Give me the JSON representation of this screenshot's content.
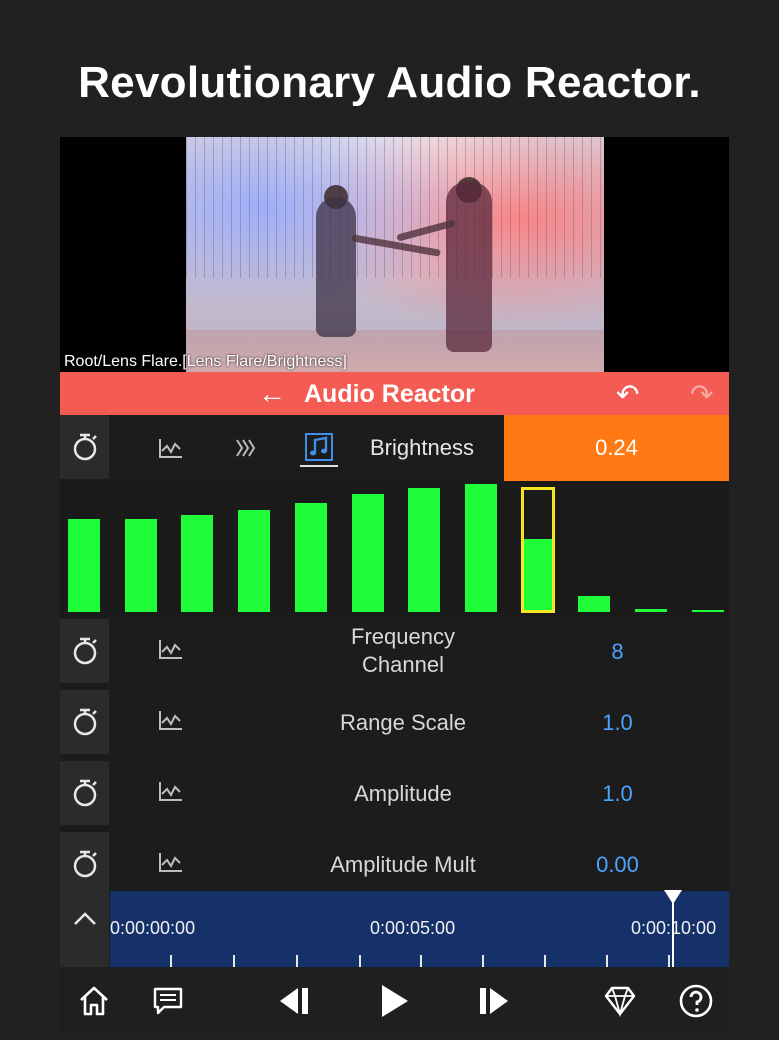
{
  "headline": "Revolutionary Audio Reactor.",
  "preview": {
    "path_label": "Root/Lens Flare.[Lens Flare/Brightness]"
  },
  "header": {
    "title": "Audio Reactor",
    "back_glyph": "←",
    "undo_glyph": "↶",
    "redo_glyph": "↷"
  },
  "selector": {
    "label": "Brightness",
    "value": "0.24"
  },
  "spectrum": {
    "bars": [
      0.74,
      0.74,
      0.77,
      0.81,
      0.87,
      0.94,
      0.99,
      1.02,
      0.58,
      0.13,
      0.02,
      0.01
    ],
    "selected_index": 8,
    "bar_color": "#1efc3a",
    "selection_color": "#f5e623"
  },
  "params": [
    {
      "label_line1": "Frequency",
      "label_line2": "Channel",
      "value": "8"
    },
    {
      "label_line1": "Range Scale",
      "label_line2": "",
      "value": "1.0"
    },
    {
      "label_line1": "Amplitude",
      "label_line2": "",
      "value": "1.0"
    },
    {
      "label_line1": "Amplitude Mult",
      "label_line2": "",
      "value": "0.00"
    }
  ],
  "timeline": {
    "times": [
      "0:00:00:00",
      "0:00:05:00",
      "0:00:10:00"
    ],
    "collapse_glyph": "^"
  },
  "colors": {
    "accent": "#f35b53",
    "value_highlight": "#ff7a14",
    "param_value": "#4aa3ff",
    "timeline_track": "#16306a"
  },
  "toolbar": {
    "icons": [
      "home-icon",
      "comment-icon",
      "step-back-icon",
      "play-icon",
      "step-forward-icon",
      "diamond-icon",
      "help-icon"
    ]
  }
}
